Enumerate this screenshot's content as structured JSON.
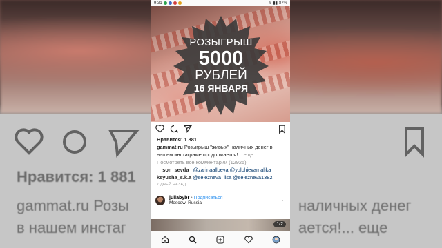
{
  "status_bar": {
    "time": "9:31",
    "battery": "87%"
  },
  "promo": {
    "line1": "РОЗЫГРЫШ",
    "line2": "5000",
    "line3": "РУБЛЕЙ",
    "line4": "16 ЯНВАРЯ"
  },
  "post": {
    "likes": "Нравится: 1 881",
    "author": "gammat.ru",
    "caption": "Розыгрыш \"живых\" наличных денег в нашем инстаграме продолжается!...",
    "more": "еще",
    "view_comments": "Посмотреть все комментарии (12925)",
    "comments": [
      {
        "user": "__son_sevda_",
        "text": "@zarinaalloeva @yulchievamalika"
      },
      {
        "user": "ksyusha_s.k.a",
        "text": "@selezneva_lisa @selezneva1382"
      }
    ],
    "time_ago": "7 ДНЕЙ НАЗАД"
  },
  "next_post": {
    "user": "juliabybr",
    "separator": "•",
    "follow": "Подписаться",
    "location": "Moscow, Russia",
    "pager": "1/2"
  },
  "background_echo": {
    "likes": "Нравится: 1 881",
    "line1": "gammat.ru Розы",
    "line1b": "наличных денег",
    "line2": "в нашем инстаг",
    "line2b": "ается!... еще"
  },
  "colors": {
    "link": "#003569",
    "follow": "#3897f0",
    "muted": "#8e8e8e"
  }
}
